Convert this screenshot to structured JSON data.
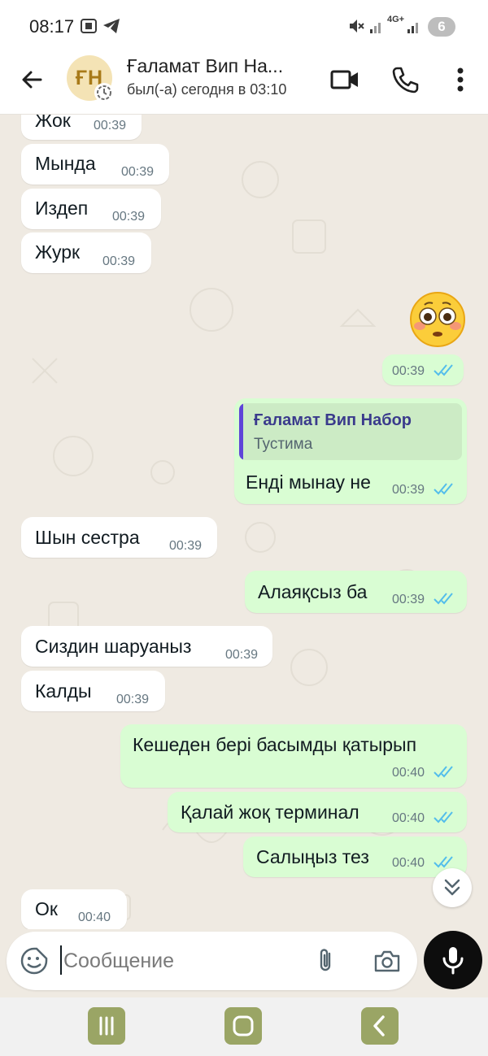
{
  "status_bar": {
    "time": "08:17",
    "network": "4G+",
    "notification_count": "6"
  },
  "header": {
    "contact_name": "Ғаламат Вип На...",
    "avatar_initials": "ҒН",
    "last_seen": "был(-а) сегодня в 03:10",
    "icons": [
      "back-arrow-icon",
      "video-call-icon",
      "phone-icon",
      "more-vert-icon"
    ]
  },
  "messages": [
    {
      "dir": "in",
      "text": "Жок",
      "time": "00:39"
    },
    {
      "dir": "in",
      "text": "Мында",
      "time": "00:39"
    },
    {
      "dir": "in",
      "text": "Издеп",
      "time": "00:39"
    },
    {
      "dir": "in",
      "text": "Журк",
      "time": "00:39"
    },
    {
      "dir": "out",
      "emoji": "flushed-face",
      "time": "00:39"
    },
    {
      "dir": "out",
      "quote_name": "Ғаламат Вип Набор",
      "quote_text": "Тустима",
      "text": "Енді мынау не",
      "time": "00:39"
    },
    {
      "dir": "in",
      "text": "Шын сестра",
      "time": "00:39"
    },
    {
      "dir": "out",
      "text": "Алаяқсыз ба",
      "time": "00:39"
    },
    {
      "dir": "in",
      "text": "Сиздин шаруаныз",
      "time": "00:39"
    },
    {
      "dir": "in",
      "text": "Калды",
      "time": "00:39"
    },
    {
      "dir": "out",
      "text": "Кешеден бері басымды қатырып",
      "time": "00:40"
    },
    {
      "dir": "out",
      "text": "Қалай жоқ терминал",
      "time": "00:40"
    },
    {
      "dir": "out",
      "text": "Салыңыз тез",
      "time": "00:40"
    },
    {
      "dir": "in",
      "text": "Ок",
      "time": "00:40"
    }
  ],
  "composer": {
    "placeholder": "Сообщение",
    "value": ""
  },
  "colors": {
    "outgoing_bubble": "#d9fdd3",
    "incoming_bubble": "#ffffff",
    "chat_background": "#efeae2",
    "read_ticks": "#53bdeb",
    "quote_accent": "#5e45d8"
  }
}
